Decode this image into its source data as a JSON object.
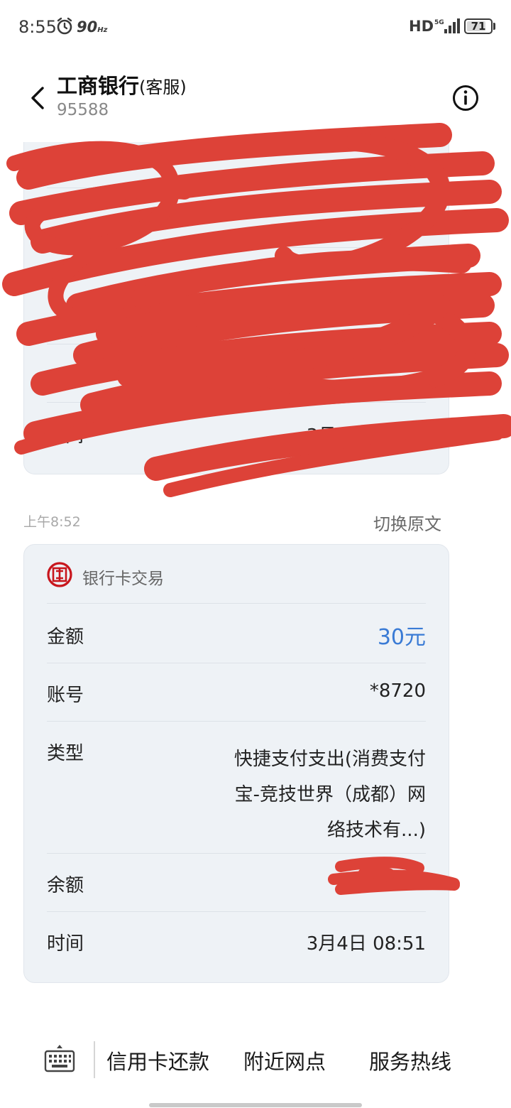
{
  "status_bar": {
    "time": "8:55",
    "refresh_rate": "90",
    "refresh_unit": "Hz",
    "hd": "HD",
    "network": "5G",
    "battery": "71"
  },
  "header": {
    "title": "工商银行",
    "title_suffix": "(客服)",
    "subtitle": "95588"
  },
  "message1": {
    "rows": [
      {
        "label": "时间",
        "value": "3月4日 07:32"
      }
    ]
  },
  "message2_meta": {
    "time": "上午8:52",
    "toggle_label": "切换原文"
  },
  "message2": {
    "title": "银行卡交易",
    "rows": [
      {
        "label": "金额",
        "value": "30元"
      },
      {
        "label": "账号",
        "value": "*8720"
      },
      {
        "label": "类型",
        "value_lines": [
          "快捷支付支出(消费支付",
          "宝-竞技世界（成都）网",
          "络技术有...)"
        ]
      },
      {
        "label": "余额",
        "value": ""
      },
      {
        "label": "时间",
        "value": "3月4日 08:51"
      }
    ]
  },
  "bottom_menu": {
    "items": [
      "信用卡还款",
      "附近网点",
      "服务热线"
    ]
  },
  "colors": {
    "accent_blue": "#3a7bd5",
    "card_bg": "#eef2f6",
    "scribble_red": "#dd4238",
    "icbc_red": "#c8161d"
  }
}
